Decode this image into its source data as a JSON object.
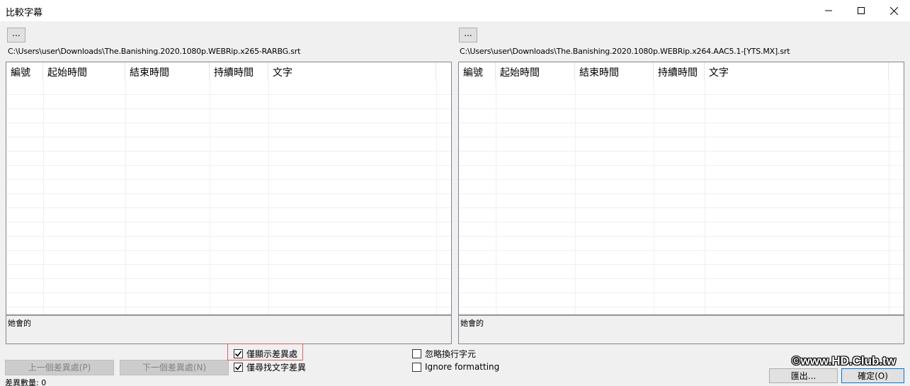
{
  "window": {
    "title": "比較字幕"
  },
  "left_panel": {
    "browse_label": "...",
    "file_path": "C:\\Users\\user\\Downloads\\The.Banishing.2020.1080p.WEBRip.x265-RARBG.srt",
    "columns": [
      "編號",
      "起始時間",
      "結束時間",
      "持續時間",
      "文字"
    ],
    "text_preview": "她會的"
  },
  "right_panel": {
    "browse_label": "...",
    "file_path": "C:\\Users\\user\\Downloads\\The.Banishing.2020.1080p.WEBRip.x264.AAC5.1-[YTS.MX].srt",
    "columns": [
      "編號",
      "起始時間",
      "結束時間",
      "持續時間",
      "文字"
    ],
    "text_preview": "她會的"
  },
  "controls": {
    "prev_diff_label": "上一個差異處(P)",
    "next_diff_label": "下一個差異處(N)",
    "show_only_diff_label": "僅顯示差異處",
    "show_only_diff_checked": true,
    "find_text_diff_label": "僅尋找文字差異",
    "find_text_diff_checked": true,
    "ignore_linebreak_label": "忽略換行字元",
    "ignore_linebreak_checked": false,
    "ignore_formatting_label": "Ignore formatting",
    "ignore_formatting_checked": false,
    "export_label": "匯出...",
    "ok_label": "確定(O)"
  },
  "status": {
    "diff_count": "差異數量: 0"
  },
  "watermark": "©www.HD.Club.tw",
  "colors": {
    "highlight_border": "#e06060",
    "disabled_button": "#cccccc"
  }
}
